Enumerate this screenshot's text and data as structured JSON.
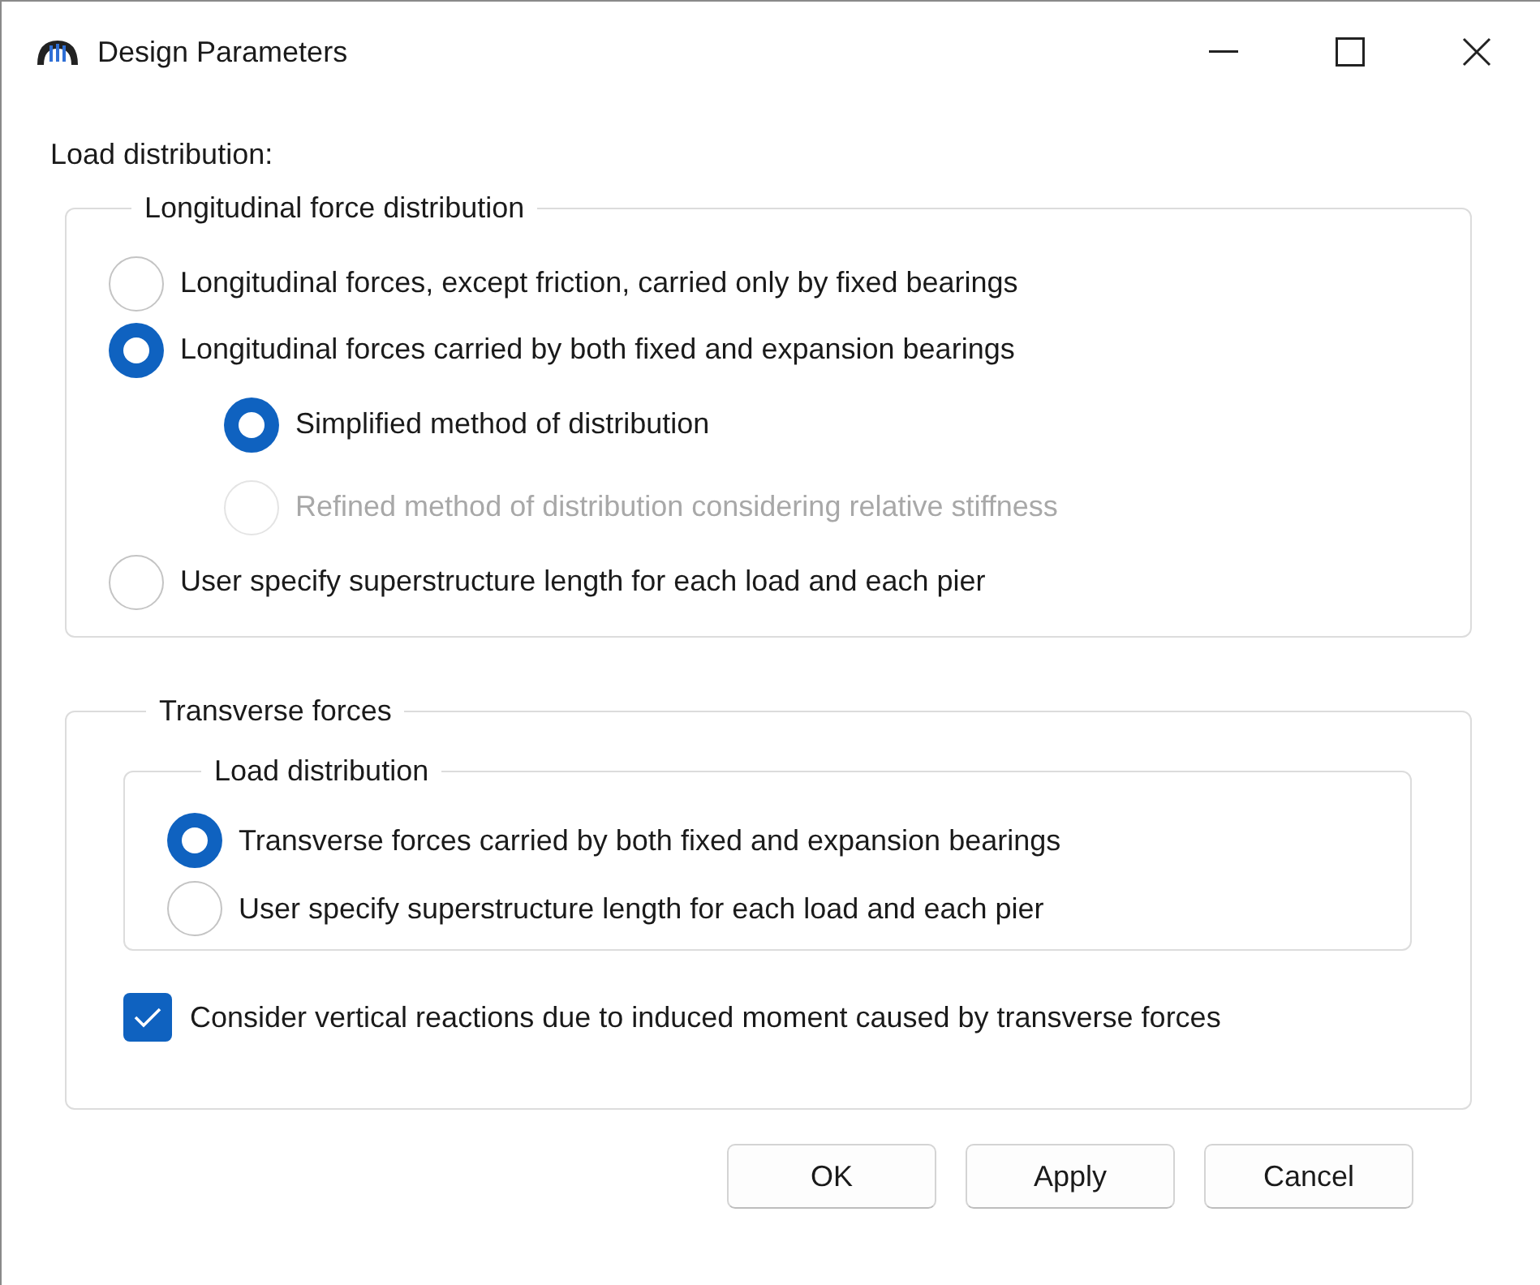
{
  "window": {
    "title": "Design Parameters"
  },
  "section_label": "Load distribution:",
  "longitudinal": {
    "title": "Longitudinal force distribution",
    "options": [
      {
        "label": "Longitudinal forces, except friction, carried only by fixed bearings",
        "selected": false,
        "disabled": false
      },
      {
        "label": "Longitudinal forces carried by both fixed and expansion bearings",
        "selected": true,
        "disabled": false,
        "children": [
          {
            "label": "Simplified method of distribution",
            "selected": true,
            "disabled": false
          },
          {
            "label": "Refined method of distribution considering relative stiffness",
            "selected": false,
            "disabled": true
          }
        ]
      },
      {
        "label": "User specify superstructure length for each load and each pier",
        "selected": false,
        "disabled": false
      }
    ]
  },
  "transverse": {
    "title": "Transverse forces",
    "load_distribution": {
      "title": "Load distribution",
      "options": [
        {
          "label": "Transverse forces carried by both fixed and expansion bearings",
          "selected": true,
          "disabled": false
        },
        {
          "label": "User specify superstructure length for each load and each pier",
          "selected": false,
          "disabled": false
        }
      ]
    },
    "checkbox": {
      "label": "Consider vertical reactions due to induced moment caused by transverse forces",
      "checked": true
    }
  },
  "buttons": [
    "OK",
    "Apply",
    "Cancel"
  ]
}
